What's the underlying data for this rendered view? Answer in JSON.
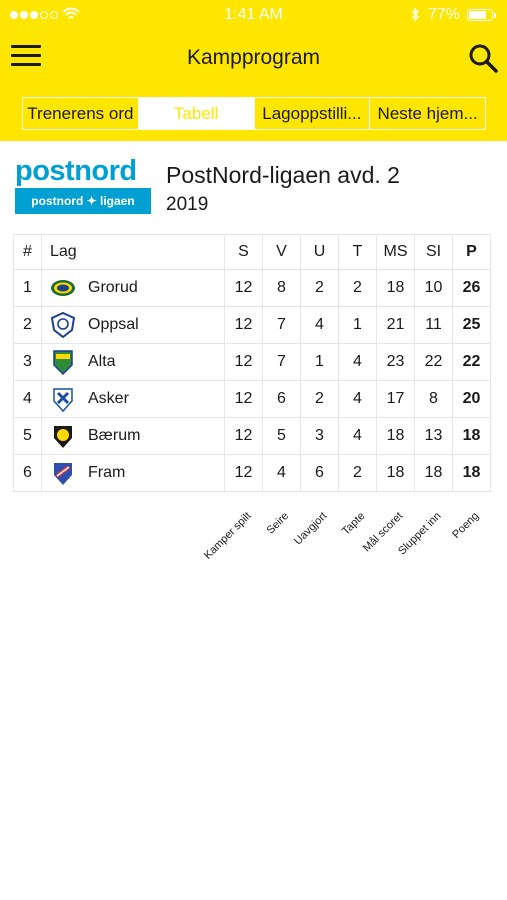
{
  "status_bar": {
    "time": "1:41 AM",
    "battery": "77%"
  },
  "header": {
    "title": "Kampprogram"
  },
  "tabs": [
    {
      "label": "Trenerens ord",
      "active": false
    },
    {
      "label": "Tabell",
      "active": true
    },
    {
      "label": "Lagoppstilli...",
      "active": false
    },
    {
      "label": "Neste hjem...",
      "active": false
    }
  ],
  "league": {
    "logo_word": "postnord",
    "logo_badge": "postnord ✦ ligaen",
    "name": "PostNord-ligaen avd. 2",
    "season": "2019"
  },
  "table": {
    "headers": {
      "rank": "#",
      "team": "Lag",
      "s": "S",
      "v": "V",
      "u": "U",
      "t": "T",
      "ms": "MS",
      "si": "SI",
      "p": "P"
    },
    "rows": [
      {
        "rank": "1",
        "team": "Grorud",
        "s": "12",
        "v": "8",
        "u": "2",
        "t": "2",
        "ms": "18",
        "si": "10",
        "p": "26"
      },
      {
        "rank": "2",
        "team": "Oppsal",
        "s": "12",
        "v": "7",
        "u": "4",
        "t": "1",
        "ms": "21",
        "si": "11",
        "p": "25"
      },
      {
        "rank": "3",
        "team": "Alta",
        "s": "12",
        "v": "7",
        "u": "1",
        "t": "4",
        "ms": "23",
        "si": "22",
        "p": "22"
      },
      {
        "rank": "4",
        "team": "Asker",
        "s": "12",
        "v": "6",
        "u": "2",
        "t": "4",
        "ms": "17",
        "si": "8",
        "p": "20"
      },
      {
        "rank": "5",
        "team": "Bærum",
        "s": "12",
        "v": "5",
        "u": "3",
        "t": "4",
        "ms": "18",
        "si": "13",
        "p": "18"
      },
      {
        "rank": "6",
        "team": "Fram",
        "s": "12",
        "v": "4",
        "u": "6",
        "t": "2",
        "ms": "18",
        "si": "18",
        "p": "18"
      }
    ]
  },
  "legend": {
    "s": "Kamper spilt",
    "v": "Seire",
    "u": "Uavgjort",
    "t": "Tapte",
    "ms": "Mål scoret",
    "si": "Sluppet inn",
    "p": "Poeng"
  },
  "colors": {
    "header": "#ffe600",
    "brand": "#00a0d2"
  }
}
